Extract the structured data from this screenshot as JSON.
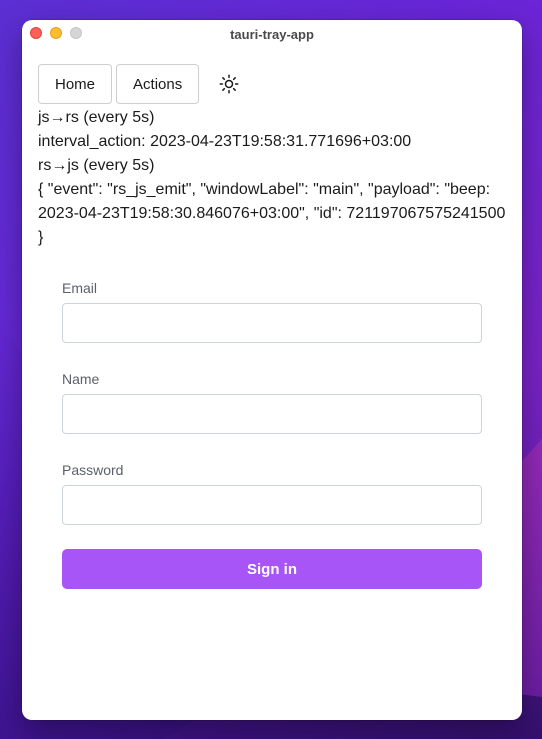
{
  "window": {
    "title": "tauri-tray-app"
  },
  "nav": {
    "home_label": "Home",
    "actions_label": "Actions",
    "theme_icon": "sun-icon"
  },
  "log": {
    "line1": "js→rs (every 5s)",
    "line2": "interval_action: 2023-04-23T19:58:31.771696+03:00",
    "line3": "rs→js (every 5s)",
    "line4": "{ \"event\": \"rs_js_emit\", \"windowLabel\": \"main\", \"payload\": \"beep: 2023-04-23T19:58:30.846076+03:00\", \"id\": 721197067575241500 }"
  },
  "form": {
    "email_label": "Email",
    "email_value": "",
    "name_label": "Name",
    "name_value": "",
    "password_label": "Password",
    "password_value": "",
    "submit_label": "Sign in"
  },
  "colors": {
    "accent": "#a855f7",
    "close": "#fe5f57",
    "minimize": "#febc2e",
    "maximize": "#d5d5d5"
  }
}
